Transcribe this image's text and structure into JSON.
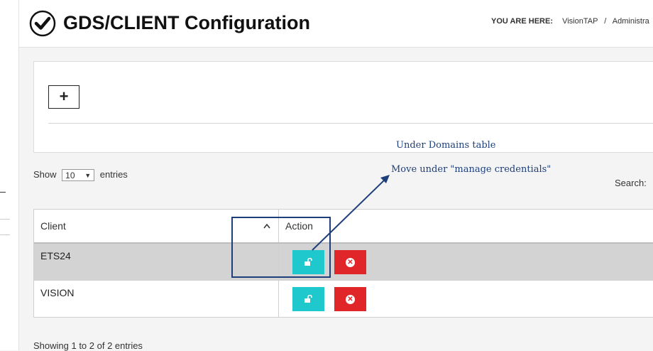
{
  "header": {
    "title": "GDS/CLIENT Configuration",
    "breadcrumb": {
      "you_are_here": "YOU ARE HERE:",
      "items": [
        "VisionTAP",
        "Administra"
      ]
    }
  },
  "panel": {
    "add_label": "+"
  },
  "annotations": {
    "note1": "Under Domains table",
    "note2": "Move under \"manage credentials\"",
    "color": "#1f3f7a"
  },
  "length_menu": {
    "show": "Show",
    "selected": "10",
    "entries": "entries"
  },
  "search": {
    "label": "Search:"
  },
  "table": {
    "columns": [
      "Client",
      "Action"
    ],
    "rows": [
      {
        "client": "ETS24"
      },
      {
        "client": "VISION"
      }
    ]
  },
  "info": "Showing 1 to 2 of 2 entries",
  "icons": {
    "title": "check-circle-icon",
    "sort": "chevron-up-icon",
    "key": "unlock-icon",
    "delete": "times-circle-icon"
  },
  "colors": {
    "key_button": "#1fc8cc",
    "delete_button": "#e02628",
    "selected_row": "#d3d3d3"
  }
}
